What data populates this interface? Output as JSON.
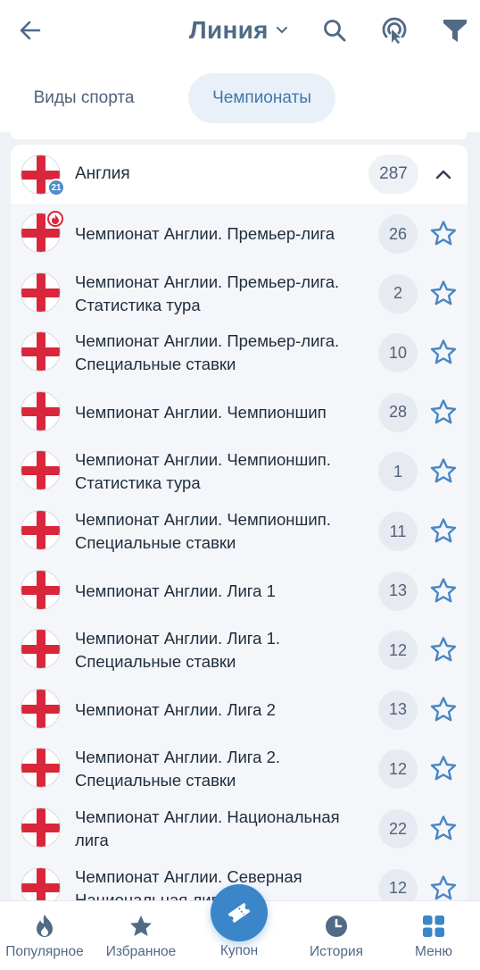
{
  "header": {
    "title": "Линия",
    "tabs": [
      {
        "label": "Виды спорта",
        "active": false
      },
      {
        "label": "Чемпионаты",
        "active": true
      }
    ]
  },
  "country": {
    "name": "Англия",
    "count": "287",
    "badge": "21",
    "expanded": true
  },
  "leagues": [
    {
      "name": "Чемпионат Англии. Премьер-лига",
      "count": "26",
      "hot": true
    },
    {
      "name": "Чемпионат Англии. Премьер-лига. Статистика тура",
      "count": "2"
    },
    {
      "name": "Чемпионат Англии. Премьер-лига. Специальные ставки",
      "count": "10"
    },
    {
      "name": "Чемпионат Англии. Чемпионшип",
      "count": "28"
    },
    {
      "name": "Чемпионат Англии. Чемпионшип. Статистика тура",
      "count": "1"
    },
    {
      "name": "Чемпионат Англии. Чемпионшип. Специальные ставки",
      "count": "11"
    },
    {
      "name": "Чемпионат Англии. Лига 1",
      "count": "13"
    },
    {
      "name": "Чемпионат Англии. Лига 1. Специальные ставки",
      "count": "12"
    },
    {
      "name": "Чемпионат Англии. Лига 2",
      "count": "13"
    },
    {
      "name": "Чемпионат Англии. Лига 2. Специальные ставки",
      "count": "12"
    },
    {
      "name": "Чемпионат Англии. Национальная лига",
      "count": "22"
    },
    {
      "name": "Чемпионат Англии. Северная Национальная лига",
      "count": "12"
    }
  ],
  "bottom_nav": {
    "popular": "Популярное",
    "favorites": "Избранное",
    "coupon": "Купон",
    "history": "История",
    "menu": "Меню"
  },
  "colors": {
    "accent": "#3a86c8",
    "nav_icon": "#516a86",
    "star": "#4a86c5",
    "flag_red": "#d9263b"
  }
}
